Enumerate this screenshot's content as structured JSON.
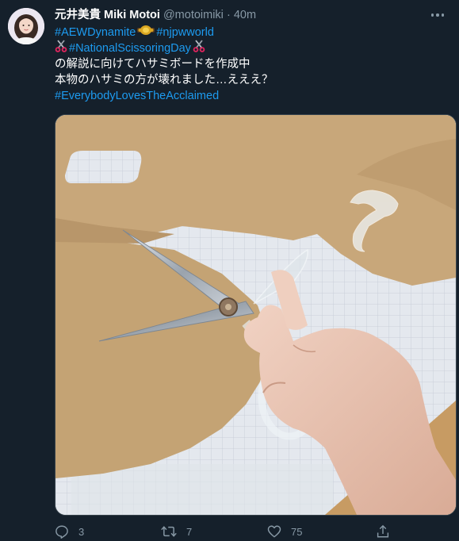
{
  "tweet": {
    "display_name": "元井美貴 Miki Motoi",
    "handle": "@motoimiki",
    "separator": "·",
    "time": "40m",
    "hashtags": {
      "aew": "#AEWDynamite",
      "njpw": "#njpwworld",
      "scissoring": "#NationalScissoringDay",
      "acclaimed": "#EverybodyLovesTheAcclaimed"
    },
    "text_line_1": "の解説に向けてハサミボードを作成中",
    "text_line_2": "本物のハサミの方が壊れました…えええ？"
  },
  "icons": {
    "avatar": "avatar-image",
    "more": "more-options-icon",
    "belt": "championship-belt-emoji",
    "scissors": "scissors-emoji",
    "reply": "reply-icon",
    "retweet": "retweet-icon",
    "like": "like-heart-icon",
    "share": "share-icon"
  },
  "media": {
    "description_icon": "photo-of-hand-cutting-cardboard-with-scissors"
  },
  "actions": {
    "reply_count": "3",
    "retweet_count": "7",
    "like_count": "75"
  },
  "colors": {
    "background": "#15202b",
    "link": "#1d9bf0",
    "secondary_text": "#8899a6",
    "cardboard": "#c8a77a",
    "cutting_mat": "#e4e8ee"
  }
}
